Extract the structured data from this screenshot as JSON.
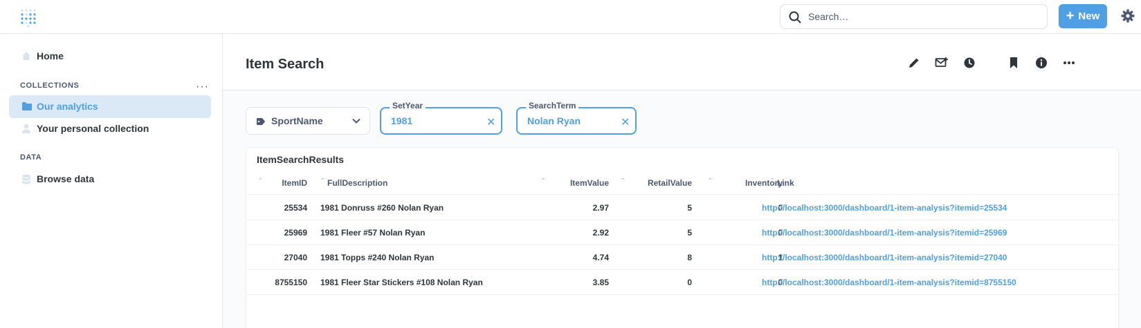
{
  "topbar": {
    "search_placeholder": "Search…",
    "new_label": "New"
  },
  "sidebar": {
    "home_label": "Home",
    "collections_label": "COLLECTIONS",
    "collections": [
      {
        "label": "Our analytics",
        "active": true
      },
      {
        "label": "Your personal collection",
        "active": false
      }
    ],
    "data_label": "DATA",
    "browse_label": "Browse data"
  },
  "dashboard": {
    "title": "Item Search"
  },
  "filters": {
    "sport": {
      "label": "SportName"
    },
    "set_year": {
      "label": "SetYear",
      "value": "1981"
    },
    "search_term": {
      "label": "SearchTerm",
      "value": "Nolan Ryan"
    }
  },
  "card": {
    "title": "ItemSearchResults",
    "columns": [
      "ItemID",
      "FullDescription",
      "ItemValue",
      "RetailValue",
      "Inventory",
      "Link"
    ],
    "rows": [
      {
        "item_id": "25534",
        "description": "1981 Donruss #260 Nolan Ryan",
        "item_value": "2.97",
        "retail_value": "5",
        "inventory": "0",
        "link": "http://localhost:3000/dashboard/1-item-analysis?itemid=25534"
      },
      {
        "item_id": "25969",
        "description": "1981 Fleer #57 Nolan Ryan",
        "item_value": "2.92",
        "retail_value": "5",
        "inventory": "0",
        "link": "http://localhost:3000/dashboard/1-item-analysis?itemid=25969"
      },
      {
        "item_id": "27040",
        "description": "1981 Topps #240 Nolan Ryan",
        "item_value": "4.74",
        "retail_value": "8",
        "inventory": "1",
        "link": "http://localhost:3000/dashboard/1-item-analysis?itemid=27040"
      },
      {
        "item_id": "8755150",
        "description": "1981 Fleer Star Stickers #108 Nolan Ryan",
        "item_value": "3.85",
        "retail_value": "0",
        "inventory": "0",
        "link": "http://localhost:3000/dashboard/1-item-analysis?itemid=8755150"
      }
    ]
  },
  "colors": {
    "brand": "#509ee3",
    "active_bg": "#dbe9f7",
    "text": "#2e353b",
    "muted": "#4c5773"
  }
}
